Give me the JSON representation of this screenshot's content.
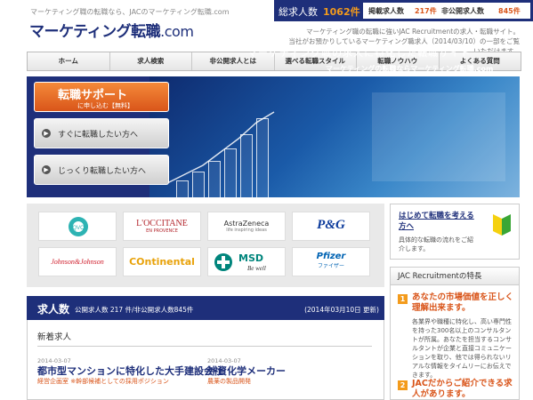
{
  "header": {
    "tagline": "マーケティング職の転職なら、JACのマーケティング転職.com",
    "logo_main": "マーケティング転職",
    "logo_suffix": ".com",
    "stats": {
      "total_label": "総求人数",
      "total_value": "1062件",
      "published_label": "掲載求人数",
      "published_value": "217件",
      "unpublished_label": "非公開求人数",
      "unpublished_value": "845件"
    },
    "intro_line1": "マーケティング職の転職に強いJAC Recruitmentの求人・転職サイト。",
    "intro_line2": "当社がお預かりしているマーケティング職求人（2014/03/10）の一部をご覧いただけます。"
  },
  "nav": {
    "items": [
      "ホーム",
      "求人検索",
      "非公開求人とは",
      "選べる転職スタイル",
      "転職ノウハウ",
      "よくある質問"
    ]
  },
  "hero": {
    "support_title": "転職サポート",
    "support_sub": "に申し込む【無料】",
    "btn_now": "すぐに転職したい方へ",
    "btn_slow": "じっくり転職したい方へ",
    "title": "マーケティング職の求人に特化した転職サイト",
    "subtitle": "マーケティングの転職ならマーケティング転職.com"
  },
  "logos": {
    "qvc": "QVC",
    "loccitane": "L'OCCITANE",
    "loccitane_sub": "EN PROVENCE",
    "astrazeneca": "AstraZeneca",
    "astrazeneca_sub": "life inspiring ideas",
    "pg": "P&G",
    "jnj": "Johnson&Johnson",
    "continental": "Ontinental",
    "msd": "MSD",
    "msd_sub": "Be well",
    "pfizer": "Pfizer",
    "pfizer_sub": "ファイザー"
  },
  "sidebar": {
    "guide_title_1": "はじめて転職を考える",
    "guide_title_2": "方へ",
    "guide_desc": "具体的な転職の流れをご紹介します。",
    "features_head": "JAC Recruitmentの特長",
    "feature1_num": "1",
    "feature1_title": "あなたの市場価値を正しく理解出来ます。",
    "feature1_desc": "各業界や職種に特化し、高い専門性を持った300名以上のコンサルタントが所属。あなたを担当するコンサルタントが企業と直接コミュニケーションを取り、他では得られないリアルな情報をタイムリーにお伝えできます。",
    "feature2_num": "2",
    "feature2_title": "JACだからご紹介できる求人があります。"
  },
  "jobs": {
    "title": "求人数",
    "counts": "公開求人数 217 件/非公開求人数845件",
    "updated": "(2014年03月10日 更新)",
    "new_label": "新着求人",
    "items": [
      {
        "date": "2014-03-07",
        "title": "都市型マンションに特化した大手建設会社",
        "sub": "経営企画室 ※幹部候補としての採用ポジション"
      },
      {
        "date": "2014-03-07",
        "title": "外資化学メーカー",
        "sub": "農薬の製品開発"
      }
    ]
  },
  "colors": {
    "navy": "#1e2f7a",
    "orange": "#f39b1c",
    "accent_red": "#d9551a"
  }
}
